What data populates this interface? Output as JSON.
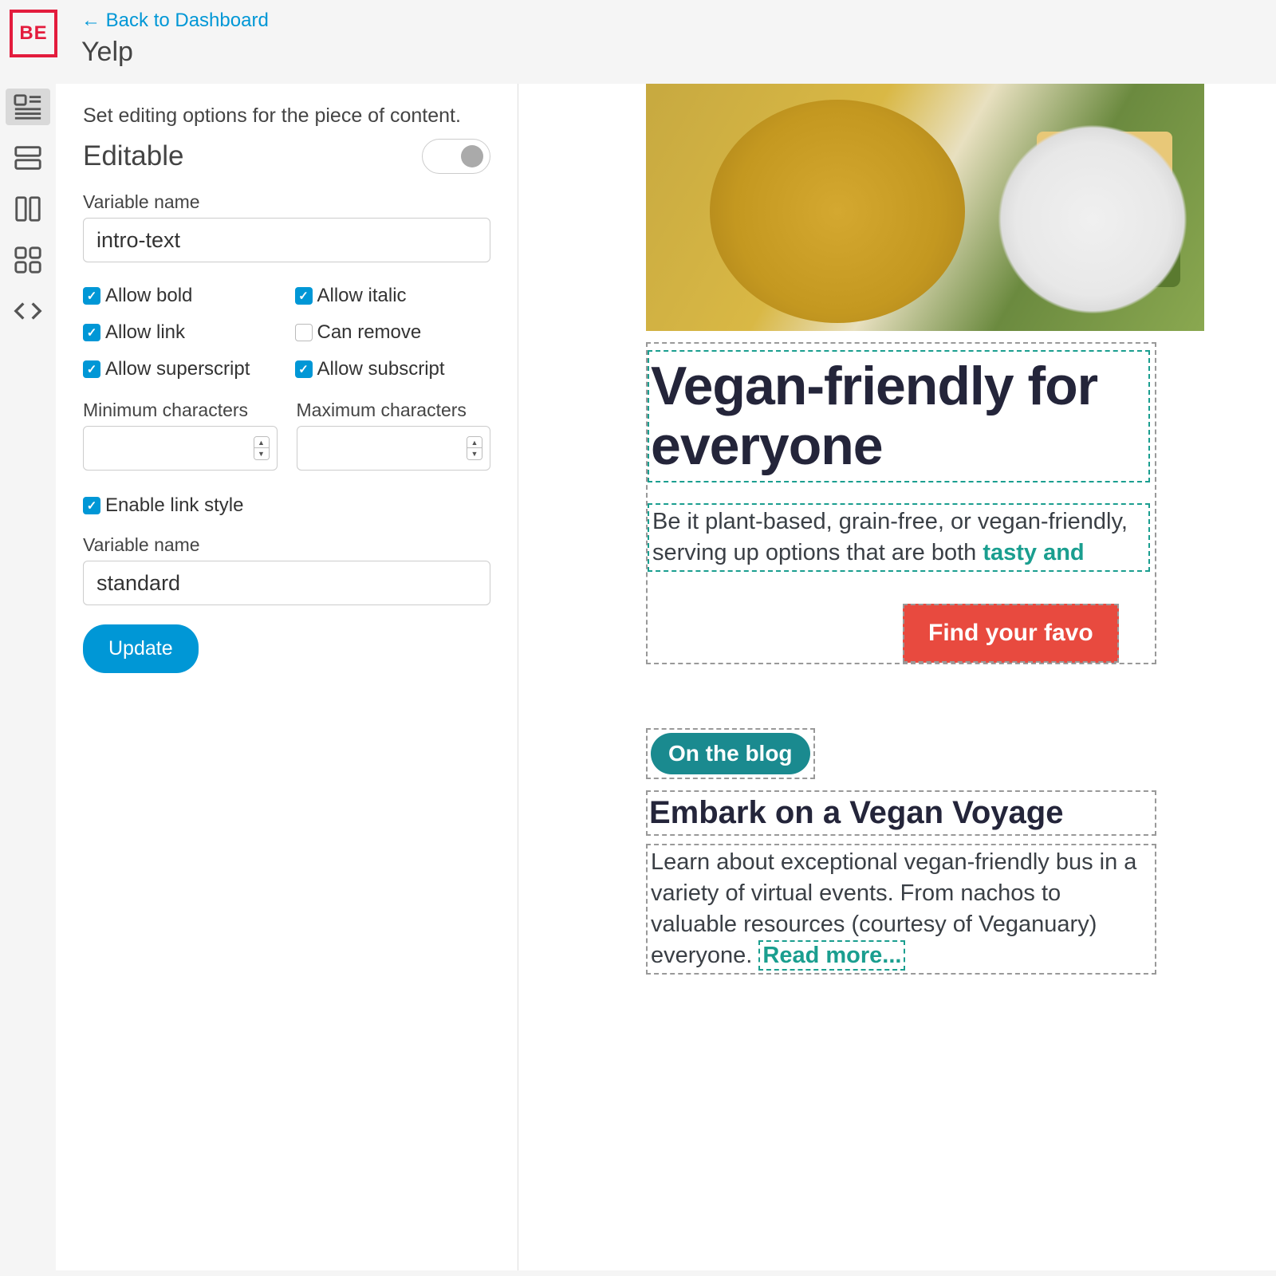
{
  "header": {
    "logo_text": "BE",
    "back_link": "← Back to Dashboard",
    "page_title": "Yelp"
  },
  "rail": {
    "items": [
      "layout-text",
      "layout-rows",
      "layout-columns",
      "layout-grid",
      "code"
    ]
  },
  "panel": {
    "description": "Set editing options for the piece of content.",
    "editable_label": "Editable",
    "var_name_label": "Variable name",
    "var_name_value": "intro-text",
    "checks": {
      "allow_bold": "Allow bold",
      "allow_italic": "Allow italic",
      "allow_link": "Allow link",
      "can_remove": "Can remove",
      "allow_superscript": "Allow superscript",
      "allow_subscript": "Allow subscript"
    },
    "min_label": "Minimum characters",
    "max_label": "Maximum characters",
    "min_value": "",
    "max_value": "",
    "enable_link_style": "Enable link style",
    "var_name_label2": "Variable name",
    "var_name_value2": "standard",
    "update_label": "Update"
  },
  "preview": {
    "heading": "Vegan-friendly for everyone",
    "intro_pre": "Be it plant-based, grain-free, or vegan-friendly, serving up options that are both ",
    "intro_hl": "tasty and",
    "cta": "Find your favo",
    "badge": "On the blog",
    "blog_title": "Embark on a Vegan Voyage",
    "blog_body": "Learn about exceptional vegan-friendly bus in a variety of virtual events. From nachos to valuable resources (courtesy of Veganuary) everyone. ",
    "read_more": "Read more..."
  }
}
